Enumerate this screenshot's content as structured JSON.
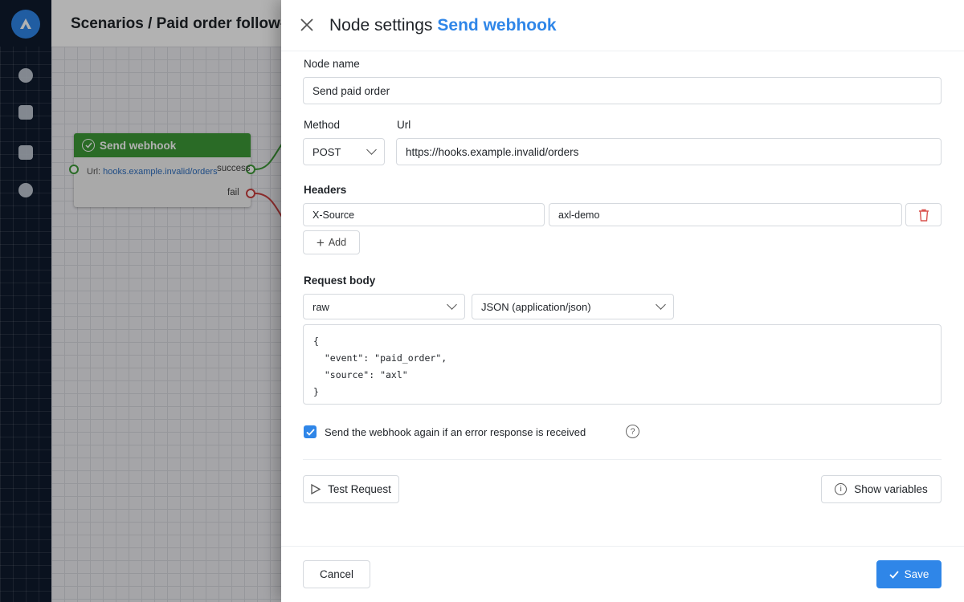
{
  "header": {
    "breadcrumb": "Scenarios / Paid order follow-up"
  },
  "canvas_node": {
    "title": "Send webhook",
    "url_label": "Url:",
    "url_value": "hooks.example.invalid/orders",
    "success_label": "success",
    "fail_label": "fail"
  },
  "panel": {
    "title": "Node settings",
    "subtitle": "Send webhook",
    "node_name_label": "Node name",
    "node_name_value": "Send paid order",
    "method_label": "Method",
    "method_value": "POST",
    "url_label": "Url",
    "url_value": "https://hooks.example.invalid/orders",
    "headers_label": "Headers",
    "headers": [
      {
        "key": "X-Source",
        "value": "axl-demo"
      }
    ],
    "add_label": "Add",
    "request_body_label": "Request body",
    "body_mode": "raw",
    "body_type": "JSON (application/json)",
    "body_code": "{\n  \"event\": \"paid_order\",\n  \"source\": \"axl\"\n}",
    "retry_checked": true,
    "retry_label": "Send the webhook again if an error response is received",
    "help_glyph": "?",
    "test_request_label": "Test Request",
    "show_variables_label": "Show variables",
    "cancel_label": "Cancel",
    "save_label": "Save"
  },
  "colors": {
    "accent": "#2f86e8",
    "node_green": "#3d9a37",
    "fail_red": "#c94040",
    "rail": "#0f1b2d"
  }
}
